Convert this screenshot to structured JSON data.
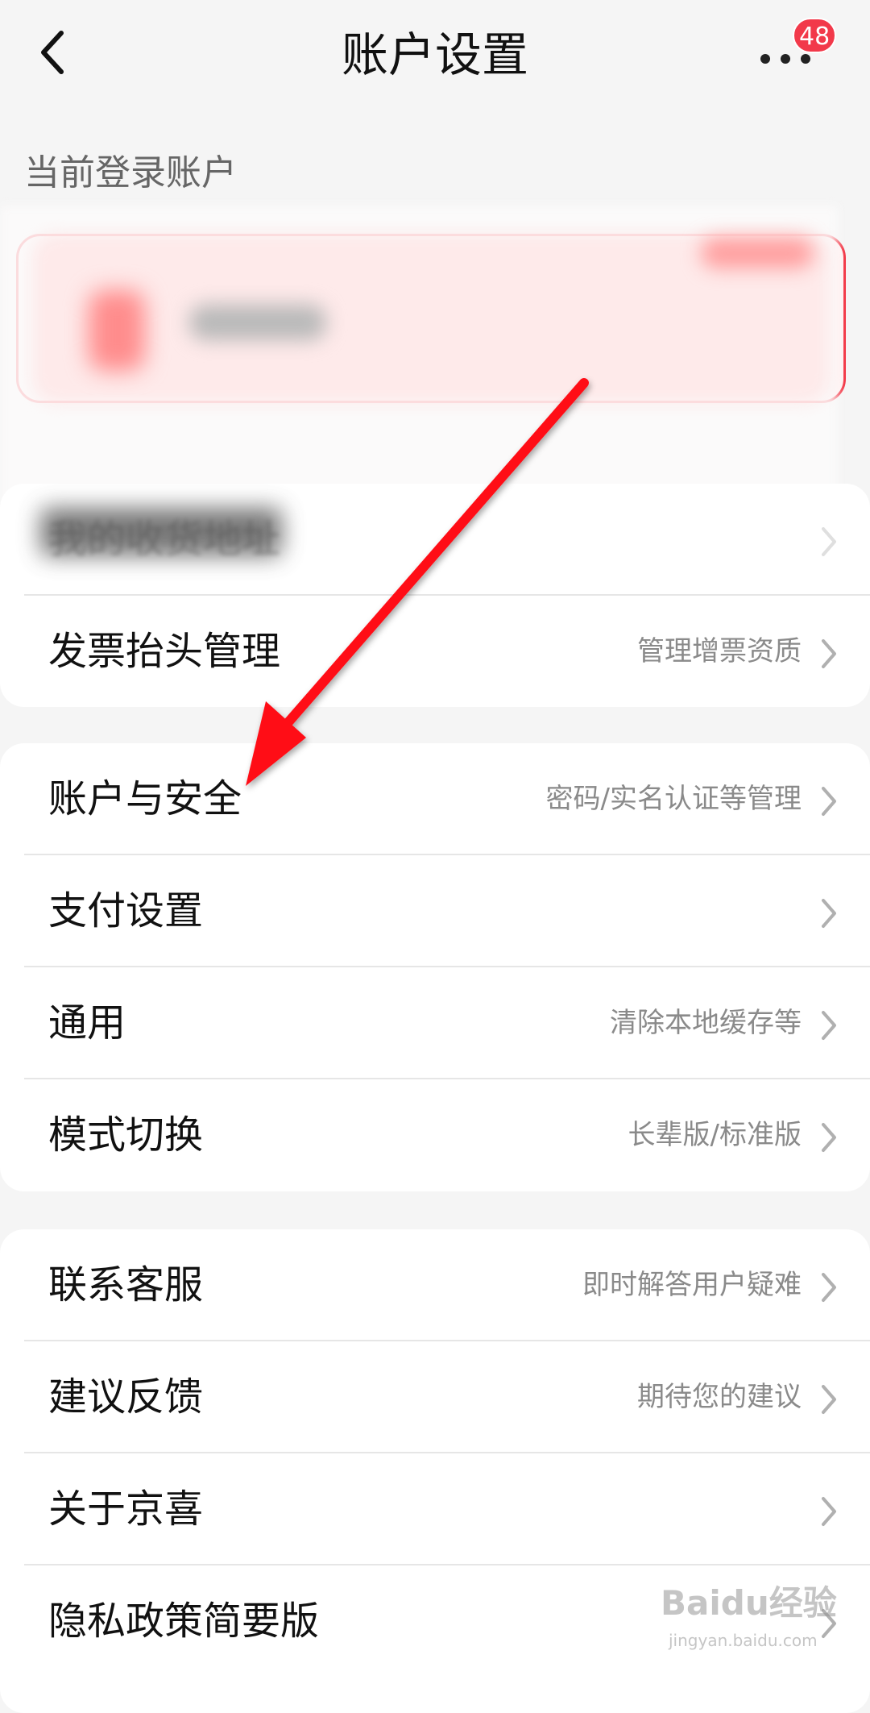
{
  "header": {
    "title": "账户设置",
    "badge_count": "48"
  },
  "account": {
    "section_label": "当前登录账户"
  },
  "group1": [
    {
      "label": "我的收货地址",
      "hint": ""
    },
    {
      "label": "发票抬头管理",
      "hint": "管理增票资质"
    }
  ],
  "group2": [
    {
      "label": "账户与安全",
      "hint": "密码/实名认证等管理"
    },
    {
      "label": "支付设置",
      "hint": ""
    },
    {
      "label": "通用",
      "hint": "清除本地缓存等"
    },
    {
      "label": "模式切换",
      "hint": "长辈版/标准版"
    }
  ],
  "group3": [
    {
      "label": "联系客服",
      "hint": "即时解答用户疑难"
    },
    {
      "label": "建议反馈",
      "hint": "期待您的建议"
    },
    {
      "label": "关于京喜",
      "hint": ""
    },
    {
      "label": "隐私政策简要版",
      "hint": ""
    }
  ],
  "watermark": {
    "text": "Baidu经验",
    "sub": "jingyan.baidu.com"
  },
  "colors": {
    "accent": "#f2394a",
    "arrow": "#ff0a14",
    "background": "#f5f5f5"
  }
}
